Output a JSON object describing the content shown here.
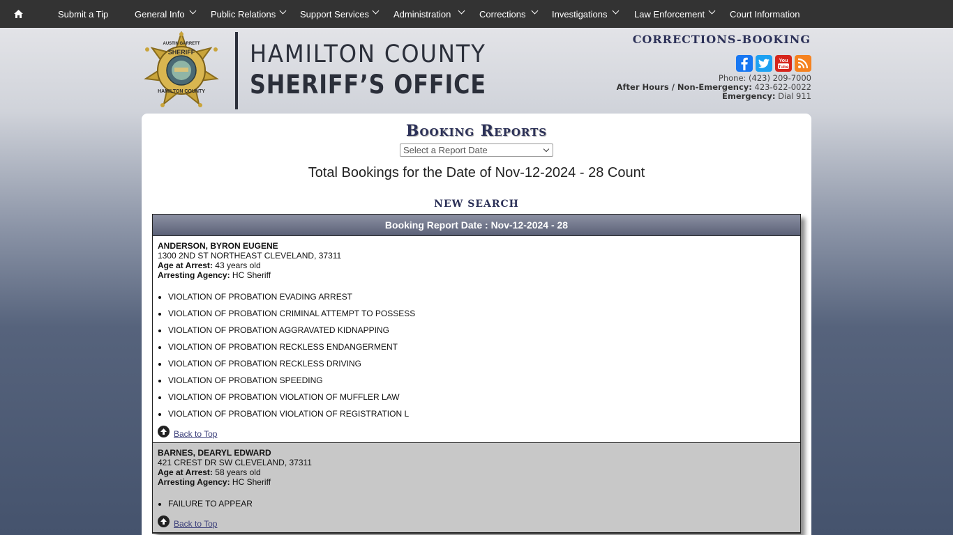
{
  "nav": {
    "home_icon": "home-icon",
    "items": [
      {
        "label": "Submit a Tip",
        "has_dropdown": false
      },
      {
        "label": "General Info",
        "has_dropdown": true
      },
      {
        "label": "Public Relations",
        "has_dropdown": true
      },
      {
        "label": "Support Services",
        "has_dropdown": true
      },
      {
        "label": "Administration",
        "has_dropdown": true
      },
      {
        "label": "Corrections",
        "has_dropdown": true
      },
      {
        "label": "Investigations",
        "has_dropdown": true
      },
      {
        "label": "Law Enforcement",
        "has_dropdown": true
      },
      {
        "label": "Court Information",
        "has_dropdown": false
      }
    ]
  },
  "header": {
    "badge_top": "AUSTIN GARRETT",
    "badge_mid": "SHERIFF",
    "badge_bottom": "HAMILTON COUNTY",
    "logo_line1": "HAMILTON COUNTY",
    "logo_line2": "SHERIFF’S OFFICE",
    "section_title": "Corrections-Booking",
    "phone_label": "Phone:",
    "phone": "(423) 209-7000",
    "after_hours_label": "After Hours / Non-Emergency:",
    "after_hours": "423-622-0022",
    "emergency_label": "Emergency:",
    "emergency": "Dial 911"
  },
  "social": [
    "facebook-icon",
    "twitter-icon",
    "youtube-icon",
    "rss-icon"
  ],
  "colors": {
    "facebook": "#1877f2",
    "twitter": "#1da1f2",
    "youtube": "#d6251c",
    "rss": "#f58220",
    "nav_bg": "#333333",
    "title": "#2c3158"
  },
  "page": {
    "title": "Booking Reports",
    "select_placeholder": "Select a Report Date",
    "total": "Total Bookings for the Date of Nov-12-2024 - 28 Count",
    "new_search": "NEW SEARCH",
    "report_header": "Booking Report Date : Nov-12-2024 - 28",
    "age_label": "Age at Arrest:",
    "agency_label": "Arresting Agency:",
    "back_to_top": "Back to Top"
  },
  "bookings": [
    {
      "name": "ANDERSON, BYRON EUGENE",
      "address": "1300 2ND ST NORTHEAST CLEVELAND, 37311",
      "age": "43 years old",
      "agency": "HC Sheriff",
      "charges": [
        "VIOLATION OF PROBATION EVADING ARREST",
        "VIOLATION OF PROBATION CRIMINAL ATTEMPT TO POSSESS",
        "VIOLATION OF PROBATION AGGRAVATED KIDNAPPING",
        "VIOLATION OF PROBATION RECKLESS ENDANGERMENT",
        "VIOLATION OF PROBATION RECKLESS DRIVING",
        "VIOLATION OF PROBATION SPEEDING",
        "VIOLATION OF PROBATION VIOLATION OF MUFFLER LAW",
        "VIOLATION OF PROBATION VIOLATION OF REGISTRATION L"
      ]
    },
    {
      "name": "BARNES, DEARYL EDWARD",
      "address": "421 CREST DR SW CLEVELAND, 37311",
      "age": "58 years old",
      "agency": "HC Sheriff",
      "charges": [
        "FAILURE TO APPEAR"
      ]
    }
  ]
}
